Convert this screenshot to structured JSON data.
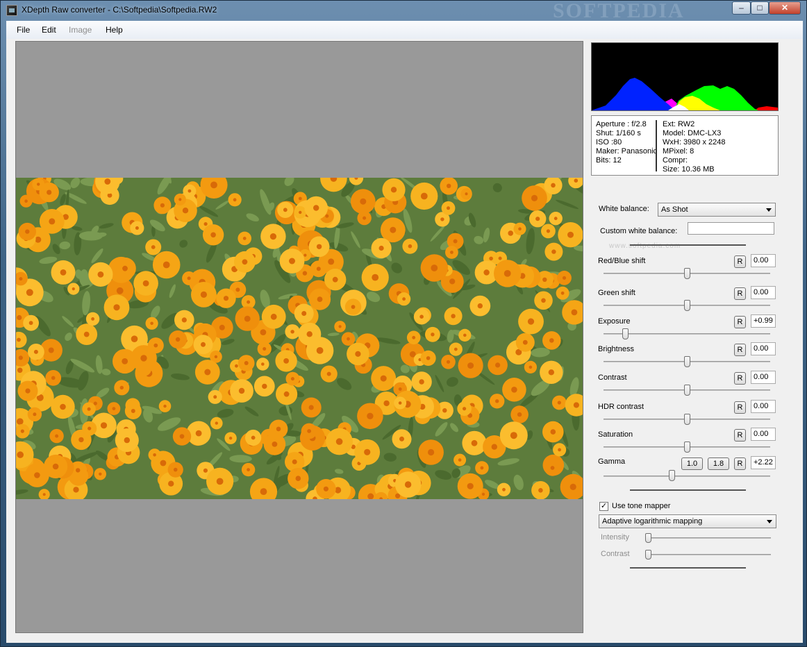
{
  "window": {
    "title": "XDepth Raw converter - C:\\Softpedia\\Softpedia.RW2",
    "watermark": "SOFTPEDIA",
    "controls": {
      "minimize": "–",
      "maximize": "□",
      "close": "✕"
    }
  },
  "menu": {
    "items": [
      "File",
      "Edit",
      "Image",
      "Help"
    ]
  },
  "info": {
    "left": [
      "Aperture : f/2.8",
      "Shut: 1/160 s",
      "ISO :80",
      "Maker: Panasonic",
      "Bits: 12"
    ],
    "right": [
      "Ext: RW2",
      "Model: DMC-LX3",
      "WxH: 3980 x 2248",
      "MPixel: 8",
      "Compr:",
      "Size: 10.36 MB"
    ]
  },
  "white_balance": {
    "label": "White balance:",
    "selected": "As Shot",
    "custom_label": "Custom white balance:",
    "custom_value": "",
    "watermark_text": "www.softpedia.com"
  },
  "adjustments": [
    {
      "key": "red_blue",
      "label": "Red/Blue shift",
      "reset": "R",
      "value": "0.00",
      "position": 0.5
    },
    {
      "key": "green",
      "label": "Green shift",
      "reset": "R",
      "value": "0.00",
      "position": 0.5
    },
    {
      "key": "exposure",
      "label": "Exposure",
      "reset": "R",
      "value": "+0.99",
      "position": 0.13
    },
    {
      "key": "brightness",
      "label": "Brightness",
      "reset": "R",
      "value": "0.00",
      "position": 0.5
    },
    {
      "key": "contrast",
      "label": "Contrast",
      "reset": "R",
      "value": "0.00",
      "position": 0.5
    },
    {
      "key": "hdr_contrast",
      "label": "HDR contrast",
      "reset": "R",
      "value": "0.00",
      "position": 0.5
    },
    {
      "key": "saturation",
      "label": "Saturation",
      "reset": "R",
      "value": "0.00",
      "position": 0.5
    }
  ],
  "gamma": {
    "label": "Gamma",
    "preset1": "1.0",
    "preset2": "1.8",
    "reset": "R",
    "value": "+2.22",
    "position": 0.41
  },
  "tone_mapper": {
    "checkbox_label": "Use tone mapper",
    "checked": true,
    "check_mark": "✓",
    "method": "Adaptive logarithmic mapping",
    "intensity_label": "Intensity",
    "contrast_label": "Contrast",
    "intensity_position": 0.0,
    "contrast_position": 0.0
  },
  "colors": {
    "histogram_bg": "#000000",
    "blue_channel": "#0022ff",
    "green_channel": "#00ff00",
    "yellow_mix": "#ffff00",
    "red_channel": "#ff0000",
    "magenta_mix": "#ff00ff",
    "viewer_bg": "#999999"
  }
}
